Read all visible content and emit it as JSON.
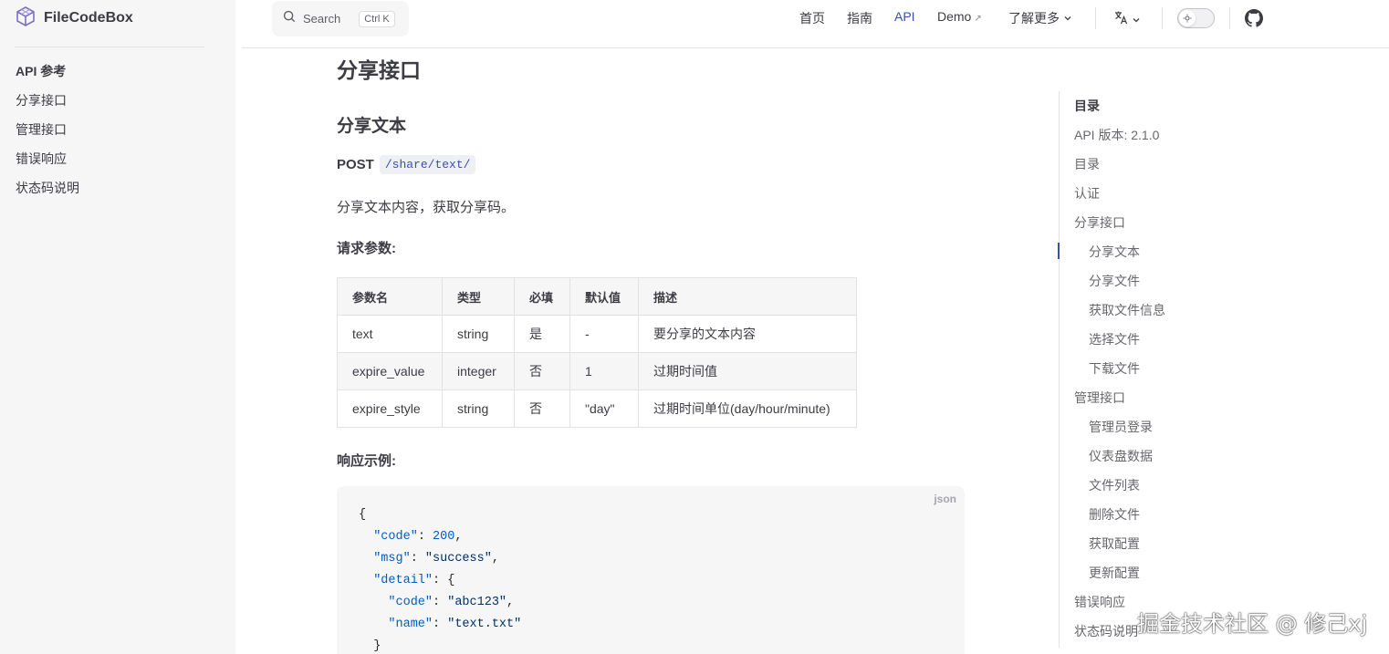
{
  "brand": {
    "title": "FileCodeBox"
  },
  "sidebar": {
    "items": [
      {
        "label": "API 参考"
      },
      {
        "label": "分享接口"
      },
      {
        "label": "管理接口"
      },
      {
        "label": "错误响应"
      },
      {
        "label": "状态码说明"
      }
    ]
  },
  "search": {
    "label": "Search",
    "shortcut_ctrl": "Ctrl",
    "shortcut_key": "K"
  },
  "nav": {
    "home": "首页",
    "guide": "指南",
    "api": "API",
    "demo": "Demo",
    "more": "了解更多"
  },
  "content": {
    "page_title": "分享接口",
    "section_title": "分享文本",
    "method": "POST",
    "path": "/share/text/",
    "description": "分享文本内容，获取分享码。",
    "params_heading": "请求参数:",
    "response_heading": "响应示例:",
    "table": {
      "headers": [
        "参数名",
        "类型",
        "必填",
        "默认值",
        "描述"
      ],
      "rows": [
        [
          "text",
          "string",
          "是",
          "-",
          "要分享的文本内容"
        ],
        [
          "expire_value",
          "integer",
          "否",
          "1",
          "过期时间值"
        ],
        [
          "expire_style",
          "string",
          "否",
          "\"day\"",
          "过期时间单位(day/hour/minute)"
        ]
      ]
    },
    "code": {
      "lang": "json",
      "open": "{",
      "code_key": "\"code\"",
      "code_val": "200",
      "msg_key": "\"msg\"",
      "msg_val": "\"success\"",
      "detail_key": "\"detail\"",
      "detail_code_key": "\"code\"",
      "detail_code_val": "\"abc123\"",
      "detail_name_key": "\"name\"",
      "detail_name_val": "\"text.txt\"",
      "close_inner": "}"
    }
  },
  "outline": {
    "title": "目录",
    "items": [
      {
        "label": "API 版本: 2.1.0",
        "level": 1
      },
      {
        "label": "目录",
        "level": 1
      },
      {
        "label": "认证",
        "level": 1
      },
      {
        "label": "分享接口",
        "level": 1
      },
      {
        "label": "分享文本",
        "level": 2,
        "active": true
      },
      {
        "label": "分享文件",
        "level": 2
      },
      {
        "label": "获取文件信息",
        "level": 2
      },
      {
        "label": "选择文件",
        "level": 2
      },
      {
        "label": "下载文件",
        "level": 2
      },
      {
        "label": "管理接口",
        "level": 1
      },
      {
        "label": "管理员登录",
        "level": 2
      },
      {
        "label": "仪表盘数据",
        "level": 2
      },
      {
        "label": "文件列表",
        "level": 2
      },
      {
        "label": "删除文件",
        "level": 2
      },
      {
        "label": "获取配置",
        "level": 2
      },
      {
        "label": "更新配置",
        "level": 2
      },
      {
        "label": "错误响应",
        "level": 1
      },
      {
        "label": "状态码说明",
        "level": 1
      }
    ]
  },
  "watermark": "掘金技术社区 @ 修己xj",
  "colors": {
    "accent": "#3451b2",
    "sidebar_bg": "#f6f6f7",
    "text": "#3c3c43"
  },
  "icons": [
    "logo-cube-icon",
    "search-icon",
    "external-link-icon",
    "chevron-down-icon",
    "translate-icon",
    "sun-icon",
    "github-icon"
  ]
}
